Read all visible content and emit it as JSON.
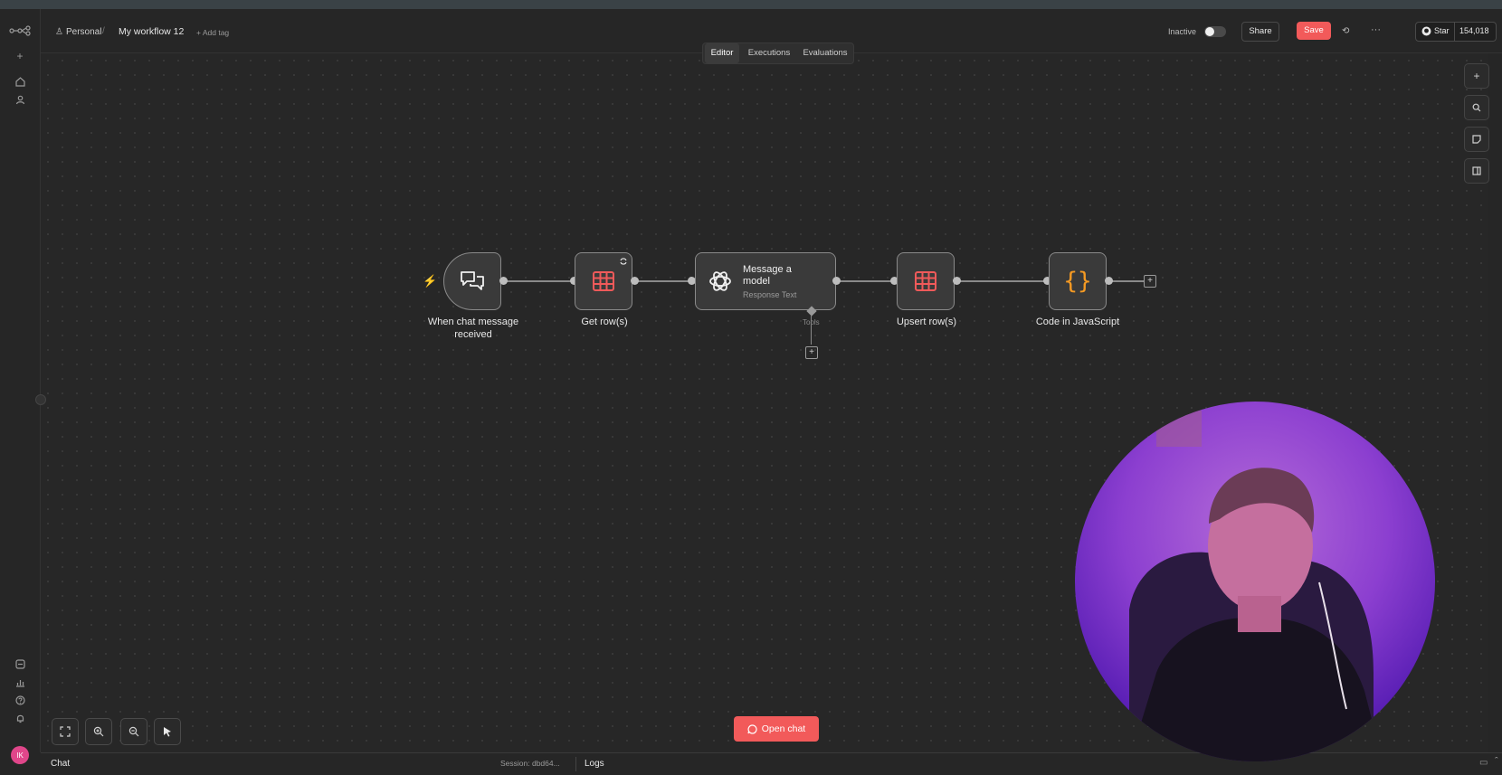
{
  "header": {
    "breadcrumb_personal": "Personal",
    "workflow_name": "My workflow 12",
    "add_tag": "+ Add tag",
    "status_label": "Inactive",
    "share_label": "Share",
    "save_label": "Save",
    "more_label": "···",
    "star_label": "Star",
    "star_count": "154,018"
  },
  "tabs": [
    "Editor",
    "Executions",
    "Evaluations"
  ],
  "nodes": [
    {
      "name": "When chat message",
      "name2": "received",
      "icon": "chat-bubbles-icon"
    },
    {
      "name": "Get row(s)",
      "icon": "table-icon"
    },
    {
      "title1": "Message a",
      "title2": "model",
      "subtitle": "Response Text",
      "icon": "openai-icon"
    },
    {
      "name": "Upsert row(s)",
      "icon": "table-icon"
    },
    {
      "name": "Code in JavaScript",
      "icon": "curly-braces-icon"
    }
  ],
  "tools_label": "Tools",
  "open_chat_label": "Open chat",
  "bottom": {
    "chat_label": "Chat",
    "session_label": "Session: dbd64...",
    "logs_label": "Logs"
  },
  "user_initials": "IK",
  "colors": {
    "accent": "#f25a5a",
    "table_icon": "#f05a5a",
    "code_icon": "#f59a23"
  }
}
